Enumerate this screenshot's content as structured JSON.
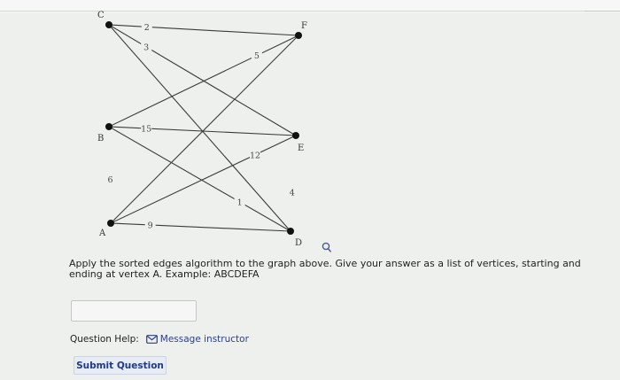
{
  "graph": {
    "vertices": [
      {
        "id": "C",
        "label": "C"
      },
      {
        "id": "F",
        "label": "F"
      },
      {
        "id": "B",
        "label": "B"
      },
      {
        "id": "E",
        "label": "E"
      },
      {
        "id": "A",
        "label": "A"
      },
      {
        "id": "D",
        "label": "D"
      }
    ],
    "edges": [
      {
        "from": "C",
        "to": "F",
        "weight": "2"
      },
      {
        "from": "C",
        "to": "E",
        "weight": "3"
      },
      {
        "from": "C",
        "to": "D",
        "weight": ""
      },
      {
        "from": "F",
        "to": "B",
        "weight": "5"
      },
      {
        "from": "F",
        "to": "A",
        "weight": ""
      },
      {
        "from": "B",
        "to": "E",
        "weight": "15"
      },
      {
        "from": "B",
        "to": "D",
        "weight": "1"
      },
      {
        "from": "A",
        "to": "E",
        "weight": "12"
      },
      {
        "from": "A",
        "to": "D",
        "weight": "9"
      },
      {
        "from": "B",
        "to": "A",
        "weight": ""
      },
      {
        "from": "C",
        "to": "A",
        "weight": "6"
      },
      {
        "from": "F",
        "to": "D",
        "weight": "4"
      }
    ]
  },
  "question": {
    "text": "Apply the sorted edges algorithm to the graph above. Give your answer as a list of vertices, starting and ending at vertex A. Example: ABCDEFA",
    "answer_value": ""
  },
  "help": {
    "label": "Question Help:",
    "message_label": "Message instructor"
  },
  "submit_label": "Submit Question",
  "colors": {
    "background": "#eef0ee",
    "edge": "#3a3a3a",
    "vertex": "#111111",
    "link": "#2b3f86",
    "button_text": "#1f3a8a"
  },
  "icons": [
    "magnify-icon",
    "envelope-icon"
  ]
}
